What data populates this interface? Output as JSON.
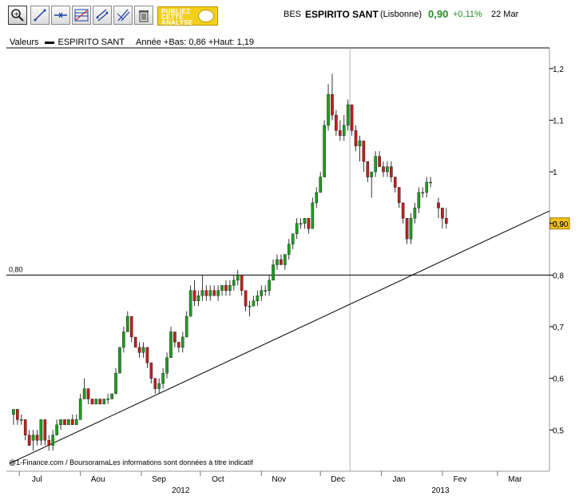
{
  "toolbar": {
    "tools": [
      "zoom-icon",
      "line-tool-icon",
      "horizontal-line-icon",
      "fibonacci-icon",
      "trend-channel-icon",
      "parallel-lines-icon",
      "trash-icon"
    ],
    "publish_lines": [
      "PUBLIEZ",
      "CETTE",
      "ANALYSE"
    ]
  },
  "quote": {
    "ticker": "BES",
    "name": "ESPIRITO SANT",
    "market": "(Lisbonne)",
    "price": "0,90",
    "variation": "+0,11%",
    "date": "22 Mar",
    "color": "#2a8a2a"
  },
  "legend": {
    "label": "Valeurs",
    "series": "ESPIRITO SANT",
    "info": "Année +Bas: 0,86 +Haut: 1,19"
  },
  "credit": "@1-Finance.com / BoursoramaLes informations sont données à titre indicatif",
  "chart_data": {
    "type": "candlestick",
    "ylim": [
      0.42,
      1.24
    ],
    "yticks": [
      0.5,
      0.6,
      0.7,
      0.8,
      0.9,
      1.0,
      1.1,
      1.2
    ],
    "ytick_labels": [
      "0,5",
      "0,6",
      "0,7",
      "0,8",
      "0,9",
      "1",
      "1,1",
      "1,2"
    ],
    "months": [
      {
        "label": "Jul",
        "day": 5
      },
      {
        "label": "Aou",
        "day": 36
      },
      {
        "label": "Sep",
        "day": 67
      },
      {
        "label": "Oct",
        "day": 97
      },
      {
        "label": "Nov",
        "day": 128
      },
      {
        "label": "Dec",
        "day": 158
      },
      {
        "label": "Jan",
        "day": 189
      },
      {
        "label": "Fev",
        "day": 220
      },
      {
        "label": "Mar",
        "day": 248
      }
    ],
    "years": [
      {
        "label": "2012",
        "day": 87
      },
      {
        "label": "2013",
        "day": 219
      }
    ],
    "day_range": [
      0,
      272
    ],
    "vline_day": 173,
    "hline": {
      "value": 0.8,
      "label": "0,80"
    },
    "trendline": [
      {
        "day": 0,
        "value": 0.435
      },
      {
        "day": 272,
        "value": 0.92
      }
    ],
    "last": {
      "value": 0.9,
      "label": "0,90"
    },
    "up_color": "#1f9e1f",
    "down_color": "#c0201e",
    "candles": [
      [
        2,
        0.53,
        0.54,
        0.51,
        0.54
      ],
      [
        4,
        0.54,
        0.54,
        0.51,
        0.52
      ],
      [
        6,
        0.52,
        0.53,
        0.51,
        0.52
      ],
      [
        8,
        0.52,
        0.52,
        0.48,
        0.49
      ],
      [
        10,
        0.49,
        0.5,
        0.47,
        0.47
      ],
      [
        12,
        0.48,
        0.5,
        0.46,
        0.49
      ],
      [
        14,
        0.49,
        0.5,
        0.47,
        0.48
      ],
      [
        16,
        0.48,
        0.52,
        0.47,
        0.52
      ],
      [
        18,
        0.52,
        0.52,
        0.47,
        0.48
      ],
      [
        20,
        0.48,
        0.49,
        0.46,
        0.47
      ],
      [
        22,
        0.47,
        0.5,
        0.46,
        0.49
      ],
      [
        24,
        0.49,
        0.52,
        0.49,
        0.51
      ],
      [
        26,
        0.51,
        0.52,
        0.5,
        0.52
      ],
      [
        28,
        0.52,
        0.52,
        0.51,
        0.51
      ],
      [
        30,
        0.51,
        0.52,
        0.51,
        0.52
      ],
      [
        32,
        0.52,
        0.53,
        0.51,
        0.51
      ],
      [
        34,
        0.51,
        0.53,
        0.51,
        0.52
      ],
      [
        36,
        0.52,
        0.57,
        0.52,
        0.56
      ],
      [
        38,
        0.56,
        0.6,
        0.56,
        0.58
      ],
      [
        40,
        0.58,
        0.58,
        0.55,
        0.56
      ],
      [
        42,
        0.56,
        0.56,
        0.55,
        0.55
      ],
      [
        44,
        0.55,
        0.56,
        0.55,
        0.56
      ],
      [
        46,
        0.56,
        0.56,
        0.55,
        0.55
      ],
      [
        48,
        0.55,
        0.56,
        0.55,
        0.56
      ],
      [
        50,
        0.56,
        0.57,
        0.55,
        0.56
      ],
      [
        52,
        0.56,
        0.57,
        0.56,
        0.57
      ],
      [
        54,
        0.57,
        0.62,
        0.57,
        0.61
      ],
      [
        56,
        0.61,
        0.66,
        0.61,
        0.66
      ],
      [
        58,
        0.66,
        0.7,
        0.65,
        0.69
      ],
      [
        60,
        0.69,
        0.73,
        0.69,
        0.72
      ],
      [
        62,
        0.72,
        0.72,
        0.67,
        0.68
      ],
      [
        64,
        0.68,
        0.68,
        0.66,
        0.66
      ],
      [
        66,
        0.66,
        0.67,
        0.64,
        0.65
      ],
      [
        68,
        0.65,
        0.67,
        0.64,
        0.66
      ],
      [
        70,
        0.66,
        0.66,
        0.62,
        0.63
      ],
      [
        72,
        0.63,
        0.63,
        0.59,
        0.6
      ],
      [
        74,
        0.6,
        0.6,
        0.57,
        0.58
      ],
      [
        76,
        0.58,
        0.6,
        0.57,
        0.59
      ],
      [
        78,
        0.59,
        0.62,
        0.58,
        0.61
      ],
      [
        80,
        0.61,
        0.65,
        0.6,
        0.64
      ],
      [
        82,
        0.64,
        0.7,
        0.64,
        0.69
      ],
      [
        84,
        0.69,
        0.69,
        0.66,
        0.67
      ],
      [
        86,
        0.67,
        0.67,
        0.65,
        0.66
      ],
      [
        88,
        0.66,
        0.69,
        0.65,
        0.68
      ],
      [
        90,
        0.68,
        0.73,
        0.68,
        0.72
      ],
      [
        92,
        0.72,
        0.78,
        0.72,
        0.77
      ],
      [
        94,
        0.77,
        0.79,
        0.74,
        0.75
      ],
      [
        96,
        0.75,
        0.77,
        0.74,
        0.76
      ],
      [
        98,
        0.76,
        0.8,
        0.75,
        0.77
      ],
      [
        100,
        0.77,
        0.78,
        0.75,
        0.76
      ],
      [
        102,
        0.76,
        0.78,
        0.75,
        0.77
      ],
      [
        104,
        0.77,
        0.78,
        0.76,
        0.76
      ],
      [
        106,
        0.76,
        0.78,
        0.75,
        0.77
      ],
      [
        108,
        0.77,
        0.78,
        0.76,
        0.78
      ],
      [
        110,
        0.78,
        0.79,
        0.76,
        0.77
      ],
      [
        112,
        0.77,
        0.79,
        0.76,
        0.78
      ],
      [
        114,
        0.78,
        0.8,
        0.77,
        0.79
      ],
      [
        116,
        0.79,
        0.81,
        0.78,
        0.8
      ],
      [
        118,
        0.8,
        0.8,
        0.76,
        0.77
      ],
      [
        120,
        0.77,
        0.77,
        0.73,
        0.74
      ],
      [
        122,
        0.74,
        0.75,
        0.72,
        0.74
      ],
      [
        124,
        0.74,
        0.76,
        0.74,
        0.75
      ],
      [
        126,
        0.75,
        0.77,
        0.74,
        0.76
      ],
      [
        128,
        0.76,
        0.78,
        0.75,
        0.77
      ],
      [
        130,
        0.77,
        0.78,
        0.76,
        0.77
      ],
      [
        132,
        0.77,
        0.8,
        0.76,
        0.79
      ],
      [
        134,
        0.79,
        0.83,
        0.79,
        0.82
      ],
      [
        136,
        0.82,
        0.84,
        0.81,
        0.83
      ],
      [
        138,
        0.83,
        0.84,
        0.82,
        0.82
      ],
      [
        140,
        0.82,
        0.84,
        0.81,
        0.84
      ],
      [
        142,
        0.84,
        0.87,
        0.83,
        0.86
      ],
      [
        144,
        0.86,
        0.88,
        0.85,
        0.88
      ],
      [
        146,
        0.88,
        0.91,
        0.87,
        0.9
      ],
      [
        148,
        0.9,
        0.91,
        0.89,
        0.9
      ],
      [
        150,
        0.9,
        0.91,
        0.89,
        0.91
      ],
      [
        152,
        0.91,
        0.91,
        0.88,
        0.89
      ],
      [
        154,
        0.89,
        0.95,
        0.89,
        0.94
      ],
      [
        156,
        0.94,
        0.97,
        0.93,
        0.96
      ],
      [
        158,
        0.96,
        1.0,
        0.96,
        0.99
      ],
      [
        160,
        0.99,
        1.1,
        0.99,
        1.09
      ],
      [
        162,
        1.09,
        1.17,
        1.08,
        1.15
      ],
      [
        164,
        1.15,
        1.19,
        1.1,
        1.11
      ],
      [
        166,
        1.11,
        1.12,
        1.07,
        1.08
      ],
      [
        168,
        1.08,
        1.1,
        1.06,
        1.07
      ],
      [
        170,
        1.07,
        1.11,
        1.06,
        1.09
      ],
      [
        172,
        1.09,
        1.14,
        1.08,
        1.13
      ],
      [
        174,
        1.13,
        1.13,
        1.07,
        1.08
      ],
      [
        176,
        1.08,
        1.09,
        1.04,
        1.05
      ],
      [
        178,
        1.05,
        1.07,
        1.02,
        1.06
      ],
      [
        180,
        1.06,
        1.06,
        1.0,
        1.02
      ],
      [
        182,
        1.02,
        1.02,
        0.98,
        0.99
      ],
      [
        184,
        0.99,
        1.0,
        0.95,
        1.0
      ],
      [
        186,
        1.0,
        1.04,
        0.99,
        1.03
      ],
      [
        188,
        1.03,
        1.04,
        1.01,
        1.01
      ],
      [
        190,
        1.01,
        1.02,
        0.99,
        1.0
      ],
      [
        192,
        1.0,
        1.02,
        0.99,
        1.01
      ],
      [
        194,
        1.01,
        1.02,
        0.98,
        0.99
      ],
      [
        196,
        0.99,
        0.99,
        0.96,
        0.97
      ],
      [
        198,
        0.97,
        0.97,
        0.93,
        0.94
      ],
      [
        200,
        0.94,
        0.94,
        0.9,
        0.91
      ],
      [
        202,
        0.91,
        0.91,
        0.86,
        0.87
      ],
      [
        204,
        0.87,
        0.92,
        0.86,
        0.91
      ],
      [
        206,
        0.91,
        0.94,
        0.9,
        0.93
      ],
      [
        208,
        0.93,
        0.97,
        0.92,
        0.96
      ],
      [
        210,
        0.96,
        0.97,
        0.95,
        0.96
      ],
      [
        212,
        0.96,
        0.99,
        0.95,
        0.98
      ],
      [
        214,
        0.98,
        0.99,
        0.97,
        0.98
      ],
      [
        218,
        0.94,
        0.95,
        0.91,
        0.93
      ],
      [
        220,
        0.93,
        0.93,
        0.89,
        0.91
      ],
      [
        222,
        0.91,
        0.93,
        0.89,
        0.9
      ]
    ]
  }
}
